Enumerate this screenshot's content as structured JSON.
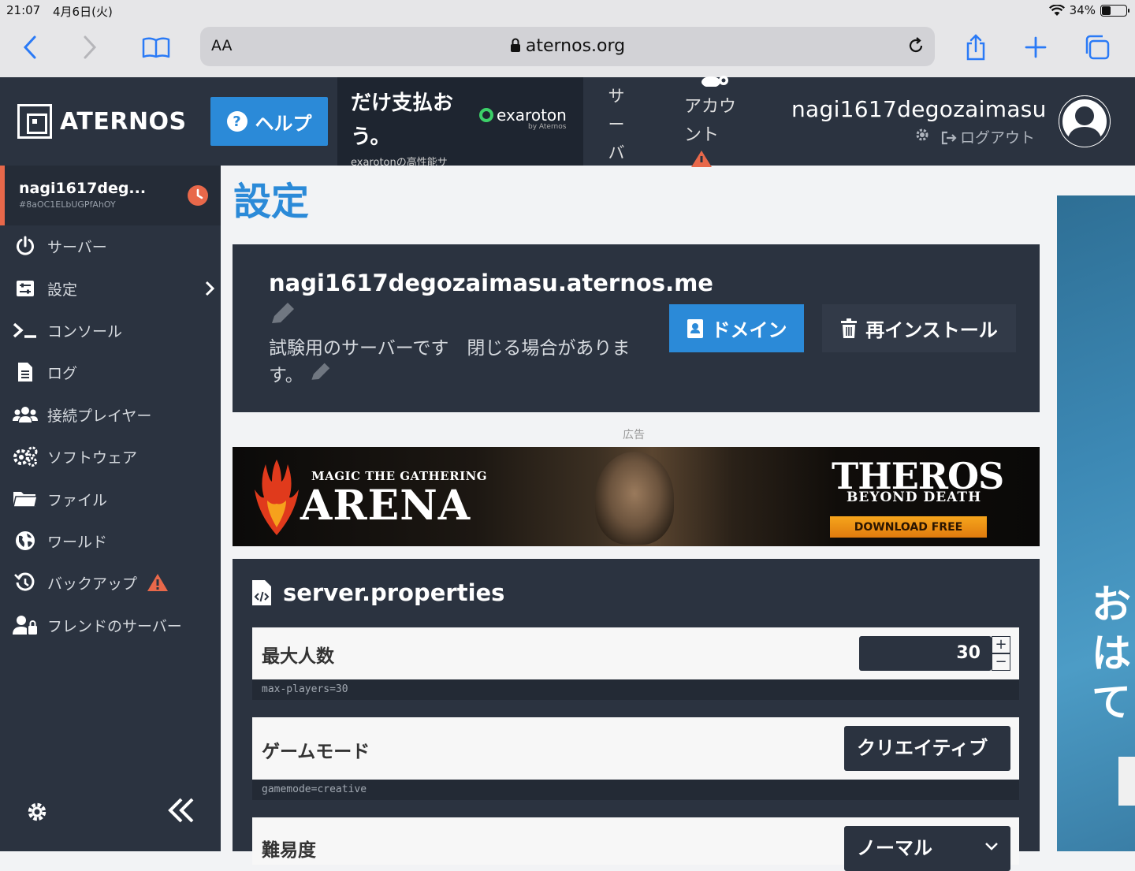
{
  "status_bar": {
    "time": "21:07",
    "date": "4月6日(火)",
    "battery": "34%",
    "battery_level": 0.34
  },
  "browser": {
    "text_size_label": "AA",
    "url": "aternos.org"
  },
  "topnav": {
    "logo_text": "ATERNOS",
    "help_label": "ヘルプ",
    "promo_headline": "だけ支払おう。",
    "promo_sub": "exarotonの高性能サ",
    "promo_brand": "exaroton",
    "promo_brand_by": "by Aternos",
    "server_label": "サーバ",
    "account_label": "アカウント",
    "username": "nagi1617degozaimasu",
    "logout_label": "ログアウト"
  },
  "sidebar": {
    "server_name": "nagi1617deg...",
    "server_id": "#8aOC1ELbUGPfAhOY",
    "items": [
      {
        "label": "サーバー",
        "icon": "power-icon"
      },
      {
        "label": "設定",
        "icon": "sliders-icon"
      },
      {
        "label": "コンソール",
        "icon": "terminal-icon"
      },
      {
        "label": "ログ",
        "icon": "file-icon"
      },
      {
        "label": "接続プレイヤー",
        "icon": "users-icon"
      },
      {
        "label": "ソフトウェア",
        "icon": "cogs-icon"
      },
      {
        "label": "ファイル",
        "icon": "folder-icon"
      },
      {
        "label": "ワールド",
        "icon": "globe-icon"
      },
      {
        "label": "バックアップ",
        "icon": "history-icon"
      },
      {
        "label": "フレンドのサーバー",
        "icon": "user-lock-icon"
      }
    ]
  },
  "main": {
    "title": "設定",
    "server_address": "nagi1617degozaimasu.aternos.me",
    "motd": "試験用のサーバーです　閉じる場合があります。",
    "domain_label": "ドメイン",
    "reinstall_label": "再インストール",
    "ad_label": "広告",
    "ad": {
      "mtg": "MAGIC THE GATHERING",
      "arena": "ARENA",
      "theros": "THEROS",
      "beyond": "BEYOND DEATH",
      "download": "DOWNLOAD FREE"
    },
    "properties_title": "server.properties",
    "properties": [
      {
        "name": "最大人数",
        "value": "30",
        "key": "max-players=30"
      },
      {
        "name": "ゲームモード",
        "value": "クリエイティブ",
        "key": "gamemode=creative"
      },
      {
        "name": "難易度",
        "value": "ノーマル"
      }
    ]
  },
  "side_ad": {
    "text": "おはて"
  },
  "colors": {
    "accent": "#2b8ad8",
    "nav_bg": "#2b3340",
    "warning": "#e8684a"
  }
}
